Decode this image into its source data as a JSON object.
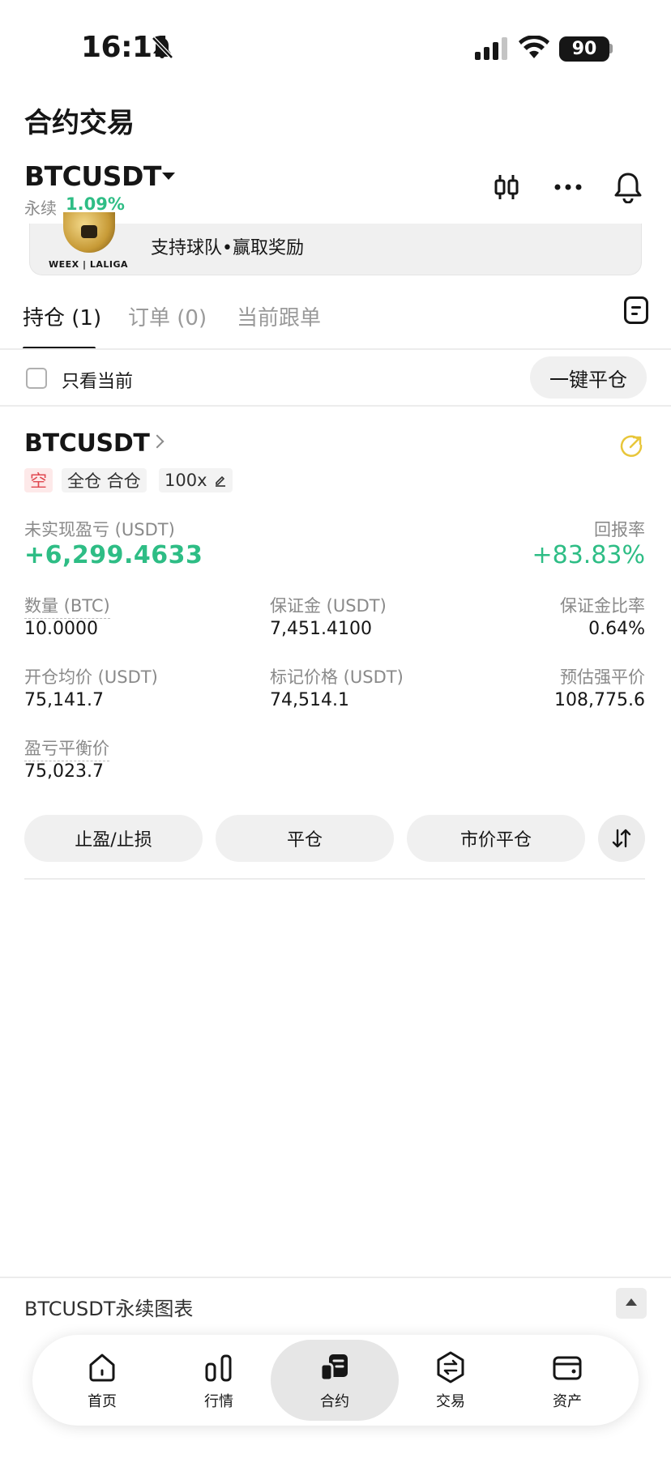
{
  "status_bar": {
    "time": "16:11",
    "battery": "90"
  },
  "header": {
    "title": "合约交易",
    "pair": "BTCUSDT",
    "perpetual_label": "永续",
    "change": "1.09%"
  },
  "banner": {
    "text": "支持球队•赢取奖励",
    "logo": "WEEX | LALIGA"
  },
  "tabs": [
    {
      "label": "持仓 (1)"
    },
    {
      "label": "订单 (0)"
    },
    {
      "label": "当前跟单"
    }
  ],
  "filter": {
    "only_current": "只看当前",
    "close_all": "一键平仓"
  },
  "position": {
    "symbol": "BTCUSDT",
    "tags": [
      "空",
      "全仓 合仓",
      "100x"
    ],
    "unrealized_pnl_label": "未实现盈亏 (USDT)",
    "unrealized_pnl": "+6,299.4633",
    "roe_label": "回报率",
    "roe": "+83.83%",
    "fields": {
      "qty_label": "数量 (BTC)",
      "qty": "10.0000",
      "margin_label": "保证金 (USDT)",
      "margin": "7,451.4100",
      "margin_ratio_label": "保证金比率",
      "margin_ratio": "0.64%",
      "entry_label": "开仓均价 (USDT)",
      "entry": "75,141.7",
      "mark_label": "标记价格 (USDT)",
      "mark": "74,514.1",
      "liq_label": "预估强平价",
      "liq": "108,775.6",
      "breakeven_label": "盈亏平衡价",
      "breakeven": "75,023.7"
    },
    "buttons": {
      "tpsl": "止盈/止损",
      "close": "平仓",
      "market_close": "市价平仓"
    }
  },
  "chart_bar": {
    "title": "BTCUSDT永续图表"
  },
  "nav": [
    {
      "label": "首页",
      "icon": "home-icon"
    },
    {
      "label": "行情",
      "icon": "market-icon"
    },
    {
      "label": "合约",
      "icon": "futures-icon"
    },
    {
      "label": "交易",
      "icon": "trade-icon"
    },
    {
      "label": "资产",
      "icon": "wallet-icon"
    }
  ],
  "colors": {
    "up": "#2ebd85",
    "short_tag": "#e0474f",
    "share_icon": "#e8c63a"
  }
}
